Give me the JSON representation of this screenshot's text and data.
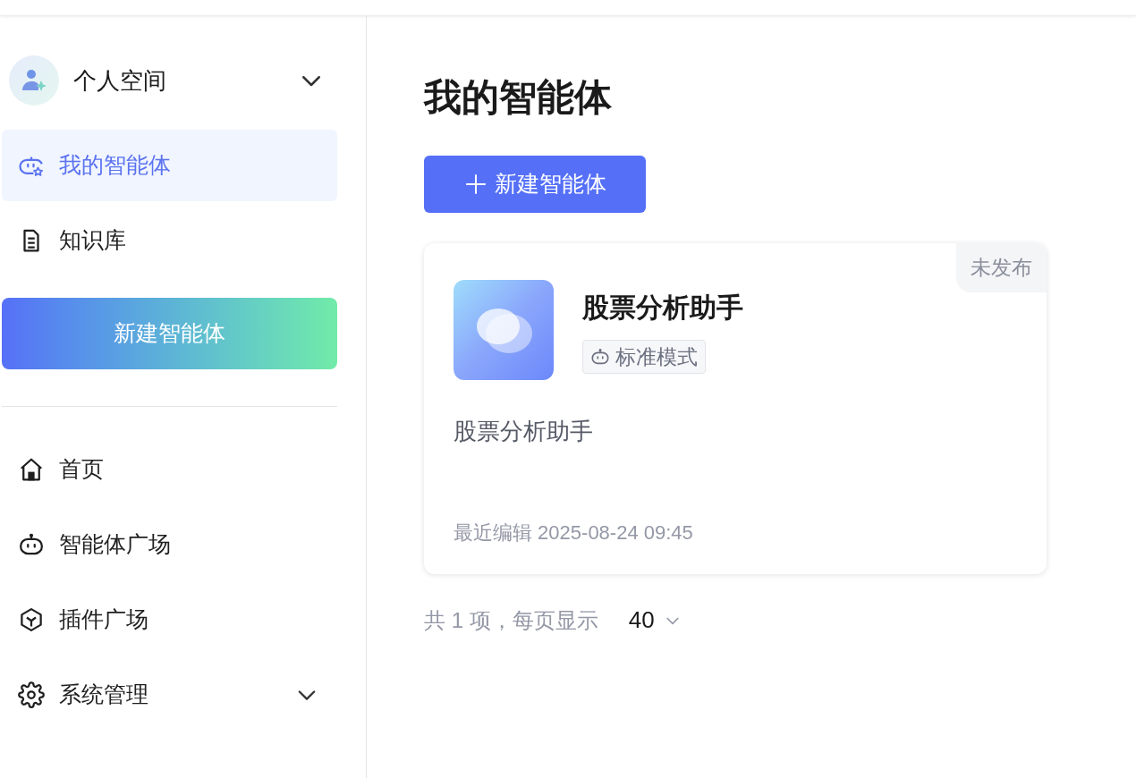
{
  "sidebar": {
    "workspace": {
      "label": "个人空间",
      "expanded": false
    },
    "top_items": [
      {
        "label": "我的智能体",
        "selected": true
      },
      {
        "label": "知识库",
        "selected": false
      }
    ],
    "create_button": "新建智能体",
    "nav_items": [
      {
        "label": "首页",
        "selected": false
      },
      {
        "label": "智能体广场",
        "selected": false
      },
      {
        "label": "插件广场",
        "selected": false
      },
      {
        "label": "系统管理",
        "selected": false,
        "expanded": false
      }
    ]
  },
  "main": {
    "title": "我的智能体",
    "new_button": "新建智能体",
    "cards": [
      {
        "name": "股票分析助手",
        "mode": "标准模式",
        "status": "未发布",
        "published": false,
        "description": "股票分析助手",
        "edited": "最近编辑 2025-08-24 09:45"
      }
    ],
    "pagination": {
      "summary": "共 1 项，每页显示",
      "page_size": "40"
    }
  }
}
